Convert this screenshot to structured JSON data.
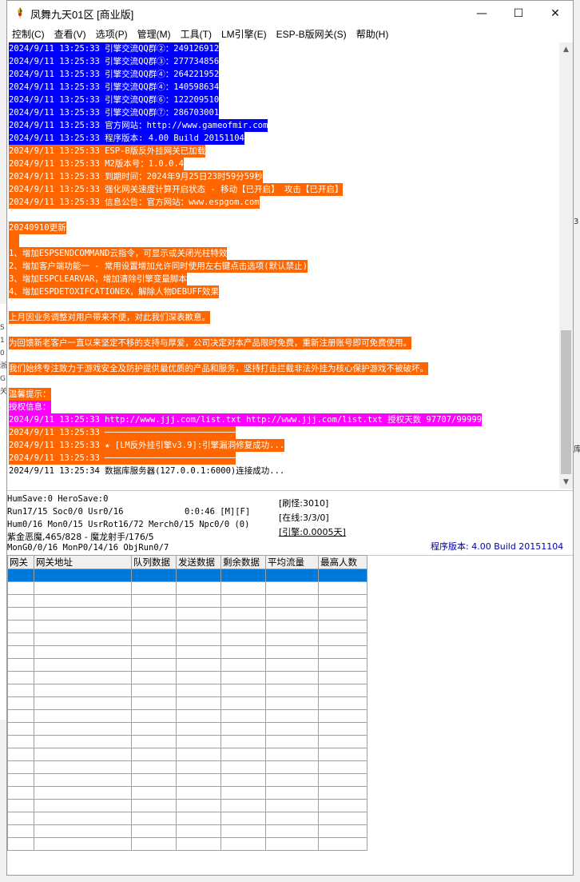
{
  "window": {
    "title": "凤舞九天01区 [商业版]",
    "buttons": {
      "minimize": "—",
      "maximize": "☐",
      "close": "✕"
    }
  },
  "menu": [
    "控制(C)",
    "查看(V)",
    "选项(P)",
    "管理(M)",
    "工具(T)",
    "LM引擎(E)",
    "ESP-B版网关(S)",
    "帮助(H)"
  ],
  "log": [
    {
      "style": "blue",
      "text": "2024/9/11 13:25:33 引擎交流QQ群②：249126912"
    },
    {
      "style": "blue",
      "text": "2024/9/11 13:25:33 引擎交流QQ群③：277734856"
    },
    {
      "style": "blue",
      "text": "2024/9/11 13:25:33 引擎交流QQ群④：264221952"
    },
    {
      "style": "blue",
      "text": "2024/9/11 13:25:33 引擎交流QQ群④：140598634"
    },
    {
      "style": "blue",
      "text": "2024/9/11 13:25:33 引擎交流QQ群⑥：122209510"
    },
    {
      "style": "blue",
      "text": "2024/9/11 13:25:33 引擎交流QQ群⑦：286703001"
    },
    {
      "style": "blue",
      "text": "2024/9/11 13:25:33 官方网站：http://www.gameofmir.com"
    },
    {
      "style": "blue",
      "text": "2024/9/11 13:25:33 程序版本: 4.00 Build 20151104"
    },
    {
      "style": "orange",
      "text": "2024/9/11 13:25:33 ESP-B版反外挂网关已加载"
    },
    {
      "style": "orange",
      "text": "2024/9/11 13:25:33 M2版本号：1.0.0.4"
    },
    {
      "style": "orange",
      "text": "2024/9/11 13:25:33 到期时间：2024年9月25日23时59分59秒"
    },
    {
      "style": "orange",
      "text": "2024/9/11 13:25:33 强化网关速度计算开启状态 - 移动【已开启】 攻击【已开启】"
    },
    {
      "style": "orange",
      "text": "2024/9/11 13:25:33 信息公告：官方网站：www.espgom.com"
    },
    {
      "style": "none",
      "text": ""
    },
    {
      "style": "orange",
      "text": "20240910更新"
    },
    {
      "style": "orange",
      "text": "  "
    },
    {
      "style": "orange",
      "text": "1、增加ESPSENDCOMMAND云指令，可显示或关闭光柱特效"
    },
    {
      "style": "orange",
      "text": "2、增加客户端功能一 - 常用设置增加允许同时使用左右键点击选项(默认禁止)"
    },
    {
      "style": "orange",
      "text": "3、增加ESPCLEARVAR，增加清除引擎变量脚本"
    },
    {
      "style": "orange",
      "text": "4、增加ESPDETOXIFCATIONEX，解除人物DEBUFF效果"
    },
    {
      "style": "none",
      "text": ""
    },
    {
      "style": "orange",
      "text": "上月因业务调整对用户带来不便，对此我们深表歉意。"
    },
    {
      "style": "none",
      "text": ""
    },
    {
      "style": "orange",
      "text": "为回馈新老客户一直以来坚定不移的支持与厚爱，公司决定对本产品限时免费，重新注册账号即可免费使用。"
    },
    {
      "style": "none",
      "text": ""
    },
    {
      "style": "orange",
      "text": "我们始终专注致力于游戏安全及防护提供最优质的产品和服务，坚持打击拦截非法外挂为核心保护游戏不被破坏。"
    },
    {
      "style": "none",
      "text": ""
    },
    {
      "style": "orange",
      "text": "温馨提示："
    },
    {
      "style": "magenta",
      "text": "授权信息："
    },
    {
      "style": "magenta",
      "text": "2024/9/11 13:25:33 http://www.jjj.com/list.txt http://www.jjj.com/list.txt 授权天数 97707/99999"
    },
    {
      "style": "orange",
      "text": "2024/9/11 13:25:33 ──────────────────────────"
    },
    {
      "style": "orange",
      "text": "2024/9/11 13:25:33 ★ [LM反外挂引擎v3.9]:引擎漏洞修复成功..."
    },
    {
      "style": "orange",
      "text": "2024/9/11 13:25:33 ──────────────────────────"
    },
    {
      "style": "plain",
      "text": "2024/9/11 13:25:34 数据库服务器(127.0.0.1:6000)连接成功..."
    }
  ],
  "status": {
    "line1": "HumSave:0 HeroSave:0",
    "line2": "Run17/15 Soc0/0 Usr0/16",
    "timer": "0:0:46 [M][F]",
    "line3": "Hum0/16 Mon0/15 UsrRot16/72 Merch0/15 Npc0/0 (0)",
    "line4": "紫金恶魔,465/828 - 魔龙射手/176/5",
    "line5": "MonG0/0/16 MonP0/14/16 ObjRun0/7",
    "refresh": "[刷怪:3010]",
    "online": "[在线:3/3/0]",
    "engine": "[引擎:0.0005天]",
    "version": "程序版本: 4.00 Build 20151104"
  },
  "grid": {
    "headers": [
      "网关",
      "网关地址",
      "队列数据",
      "发送数据",
      "剩余数据",
      "平均流量",
      "最高人数"
    ]
  },
  "background_fragments": {
    "left": [
      "S",
      "1",
      "0",
      "浙",
      "G",
      "关"
    ],
    "right": [
      "3",
      "库"
    ]
  },
  "colors": {
    "log_blue": "#0000ff",
    "log_orange": "#ff6600",
    "log_magenta": "#ff00ff",
    "selection": "#0078d7",
    "version_text": "#0000aa"
  }
}
